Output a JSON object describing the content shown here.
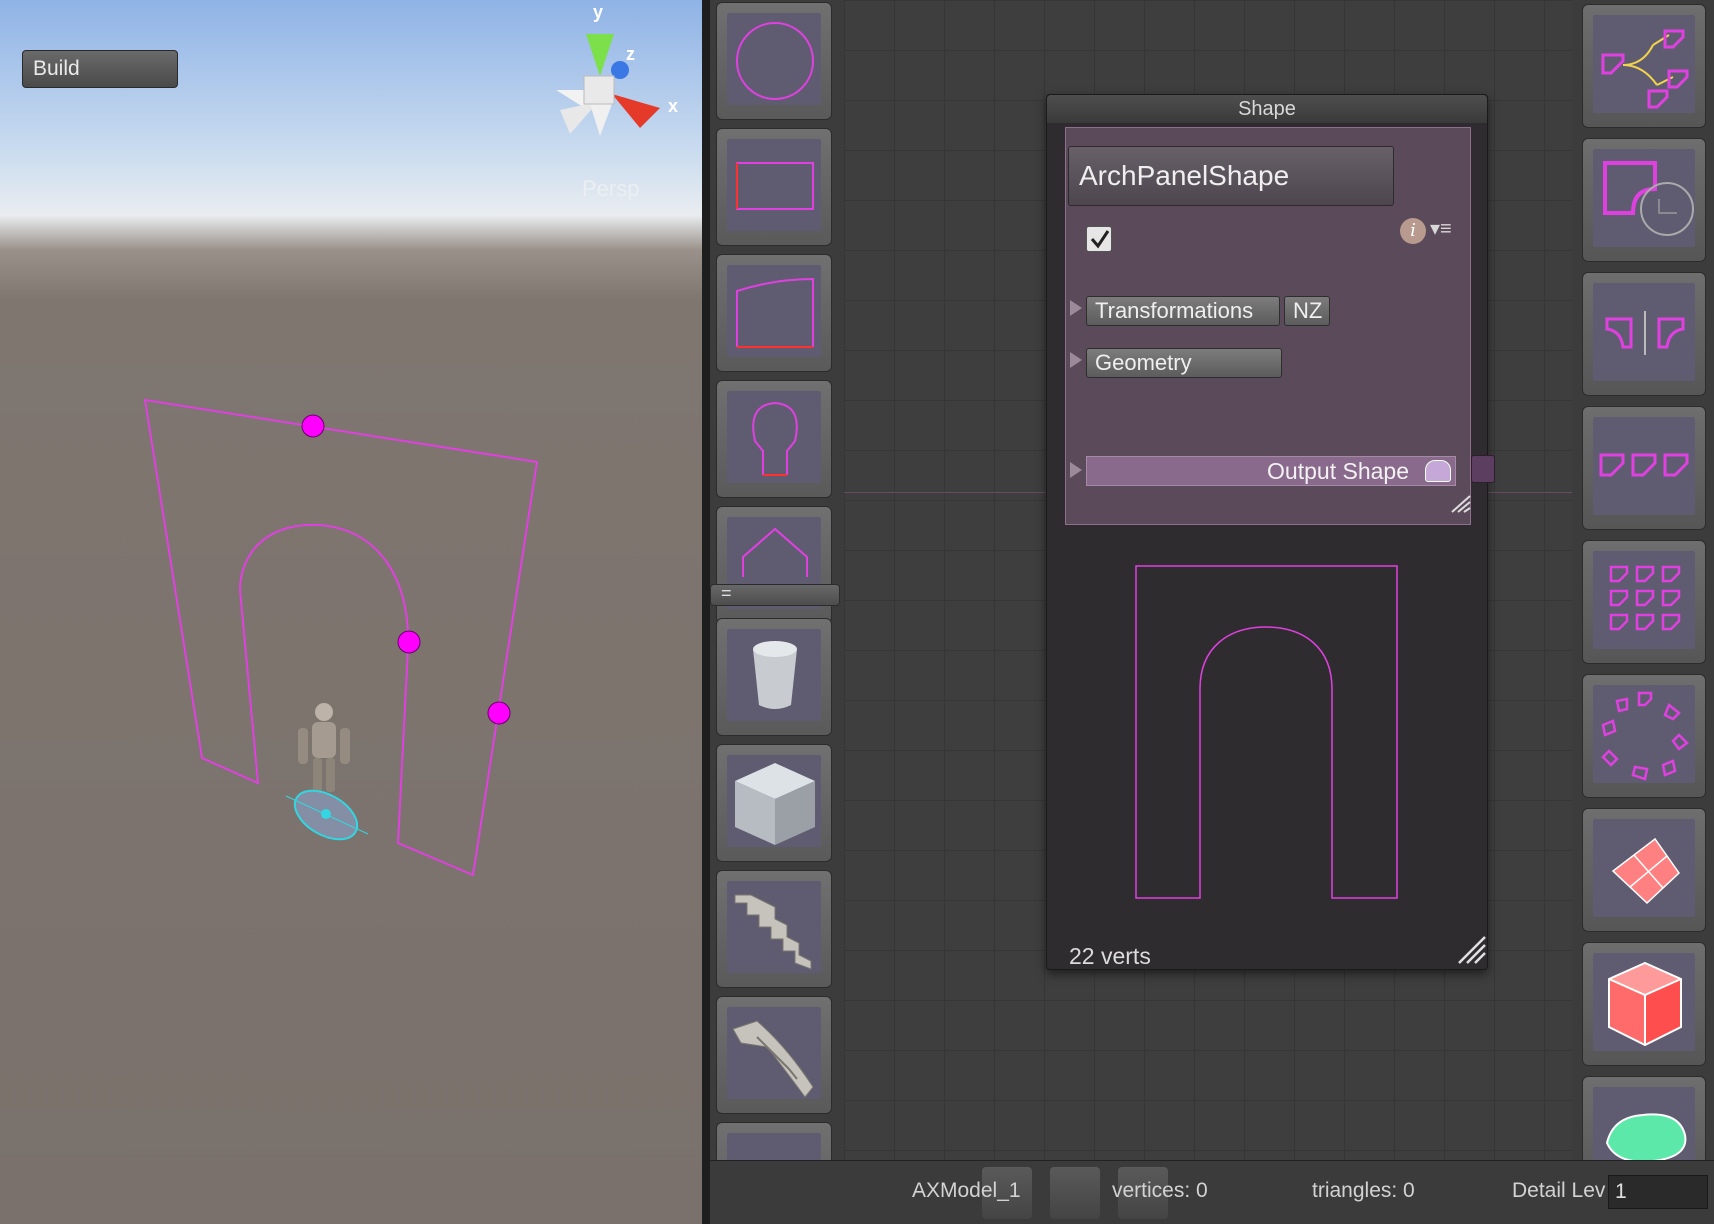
{
  "scene": {
    "build_label": "Build",
    "persp_label": "Persp",
    "axis_labels": {
      "y": "y",
      "z": "z",
      "x": "x"
    }
  },
  "library": {
    "items": [
      "circle-shape",
      "rectangle-shape",
      "curved-top-shape",
      "keyhole-shape",
      "pentagon-shape",
      "cylinder-mesh",
      "cube-mesh",
      "stairs-mesh",
      "curved-stairs-mesh",
      "partial-item"
    ],
    "separator_label": "="
  },
  "node": {
    "title": "Shape",
    "name_value": "ArchPanelShape",
    "enabled": true,
    "transformations_label": "Transformations",
    "nz_label": "NZ",
    "geometry_label": "Geometry",
    "output_label": "Output Shape",
    "verts_label": "22 verts"
  },
  "palette": {
    "items": [
      "shape-merge-icon",
      "shape-offset-icon",
      "mirror-icon",
      "linear-repeat-icon",
      "grid-repeat-icon",
      "radial-repeat-icon",
      "plane-icon",
      "box-icon",
      "freeform-shape-icon"
    ]
  },
  "status": {
    "model_label": "AXModel_1",
    "vertices_label": "vertices: 0",
    "triangles_label": "triangles: 0",
    "detail_label": "Detail Lev",
    "detail_value": "1"
  },
  "colors": {
    "shape_stroke": "#e040e0",
    "handle": "#ff00ff",
    "node_body": "#5b4a5a"
  }
}
